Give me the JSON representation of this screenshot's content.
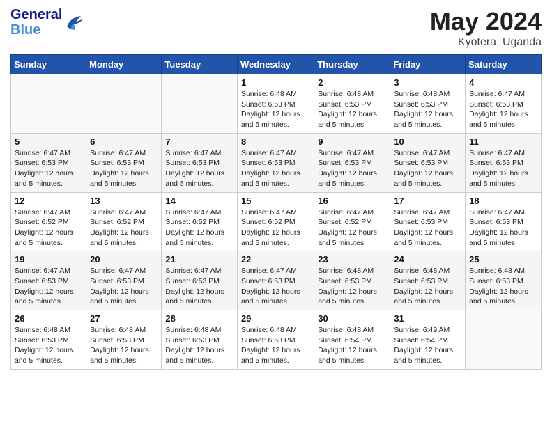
{
  "header": {
    "logo_general": "General",
    "logo_blue": "Blue",
    "title": "May 2024",
    "location": "Kyotera, Uganda"
  },
  "days_of_week": [
    "Sunday",
    "Monday",
    "Tuesday",
    "Wednesday",
    "Thursday",
    "Friday",
    "Saturday"
  ],
  "weeks": [
    [
      {
        "day": "",
        "info": ""
      },
      {
        "day": "",
        "info": ""
      },
      {
        "day": "",
        "info": ""
      },
      {
        "day": "1",
        "info": "Sunrise: 6:48 AM\nSunset: 6:53 PM\nDaylight: 12 hours\nand 5 minutes."
      },
      {
        "day": "2",
        "info": "Sunrise: 6:48 AM\nSunset: 6:53 PM\nDaylight: 12 hours\nand 5 minutes."
      },
      {
        "day": "3",
        "info": "Sunrise: 6:48 AM\nSunset: 6:53 PM\nDaylight: 12 hours\nand 5 minutes."
      },
      {
        "day": "4",
        "info": "Sunrise: 6:47 AM\nSunset: 6:53 PM\nDaylight: 12 hours\nand 5 minutes."
      }
    ],
    [
      {
        "day": "5",
        "info": "Sunrise: 6:47 AM\nSunset: 6:53 PM\nDaylight: 12 hours\nand 5 minutes."
      },
      {
        "day": "6",
        "info": "Sunrise: 6:47 AM\nSunset: 6:53 PM\nDaylight: 12 hours\nand 5 minutes."
      },
      {
        "day": "7",
        "info": "Sunrise: 6:47 AM\nSunset: 6:53 PM\nDaylight: 12 hours\nand 5 minutes."
      },
      {
        "day": "8",
        "info": "Sunrise: 6:47 AM\nSunset: 6:53 PM\nDaylight: 12 hours\nand 5 minutes."
      },
      {
        "day": "9",
        "info": "Sunrise: 6:47 AM\nSunset: 6:53 PM\nDaylight: 12 hours\nand 5 minutes."
      },
      {
        "day": "10",
        "info": "Sunrise: 6:47 AM\nSunset: 6:53 PM\nDaylight: 12 hours\nand 5 minutes."
      },
      {
        "day": "11",
        "info": "Sunrise: 6:47 AM\nSunset: 6:53 PM\nDaylight: 12 hours\nand 5 minutes."
      }
    ],
    [
      {
        "day": "12",
        "info": "Sunrise: 6:47 AM\nSunset: 6:52 PM\nDaylight: 12 hours\nand 5 minutes."
      },
      {
        "day": "13",
        "info": "Sunrise: 6:47 AM\nSunset: 6:52 PM\nDaylight: 12 hours\nand 5 minutes."
      },
      {
        "day": "14",
        "info": "Sunrise: 6:47 AM\nSunset: 6:52 PM\nDaylight: 12 hours\nand 5 minutes."
      },
      {
        "day": "15",
        "info": "Sunrise: 6:47 AM\nSunset: 6:52 PM\nDaylight: 12 hours\nand 5 minutes."
      },
      {
        "day": "16",
        "info": "Sunrise: 6:47 AM\nSunset: 6:52 PM\nDaylight: 12 hours\nand 5 minutes."
      },
      {
        "day": "17",
        "info": "Sunrise: 6:47 AM\nSunset: 6:53 PM\nDaylight: 12 hours\nand 5 minutes."
      },
      {
        "day": "18",
        "info": "Sunrise: 6:47 AM\nSunset: 6:53 PM\nDaylight: 12 hours\nand 5 minutes."
      }
    ],
    [
      {
        "day": "19",
        "info": "Sunrise: 6:47 AM\nSunset: 6:53 PM\nDaylight: 12 hours\nand 5 minutes."
      },
      {
        "day": "20",
        "info": "Sunrise: 6:47 AM\nSunset: 6:53 PM\nDaylight: 12 hours\nand 5 minutes."
      },
      {
        "day": "21",
        "info": "Sunrise: 6:47 AM\nSunset: 6:53 PM\nDaylight: 12 hours\nand 5 minutes."
      },
      {
        "day": "22",
        "info": "Sunrise: 6:47 AM\nSunset: 6:53 PM\nDaylight: 12 hours\nand 5 minutes."
      },
      {
        "day": "23",
        "info": "Sunrise: 6:48 AM\nSunset: 6:53 PM\nDaylight: 12 hours\nand 5 minutes."
      },
      {
        "day": "24",
        "info": "Sunrise: 6:48 AM\nSunset: 6:53 PM\nDaylight: 12 hours\nand 5 minutes."
      },
      {
        "day": "25",
        "info": "Sunrise: 6:48 AM\nSunset: 6:53 PM\nDaylight: 12 hours\nand 5 minutes."
      }
    ],
    [
      {
        "day": "26",
        "info": "Sunrise: 6:48 AM\nSunset: 6:53 PM\nDaylight: 12 hours\nand 5 minutes."
      },
      {
        "day": "27",
        "info": "Sunrise: 6:48 AM\nSunset: 6:53 PM\nDaylight: 12 hours\nand 5 minutes."
      },
      {
        "day": "28",
        "info": "Sunrise: 6:48 AM\nSunset: 6:53 PM\nDaylight: 12 hours\nand 5 minutes."
      },
      {
        "day": "29",
        "info": "Sunrise: 6:48 AM\nSunset: 6:53 PM\nDaylight: 12 hours\nand 5 minutes."
      },
      {
        "day": "30",
        "info": "Sunrise: 6:48 AM\nSunset: 6:54 PM\nDaylight: 12 hours\nand 5 minutes."
      },
      {
        "day": "31",
        "info": "Sunrise: 6:49 AM\nSunset: 6:54 PM\nDaylight: 12 hours\nand 5 minutes."
      },
      {
        "day": "",
        "info": ""
      }
    ]
  ]
}
